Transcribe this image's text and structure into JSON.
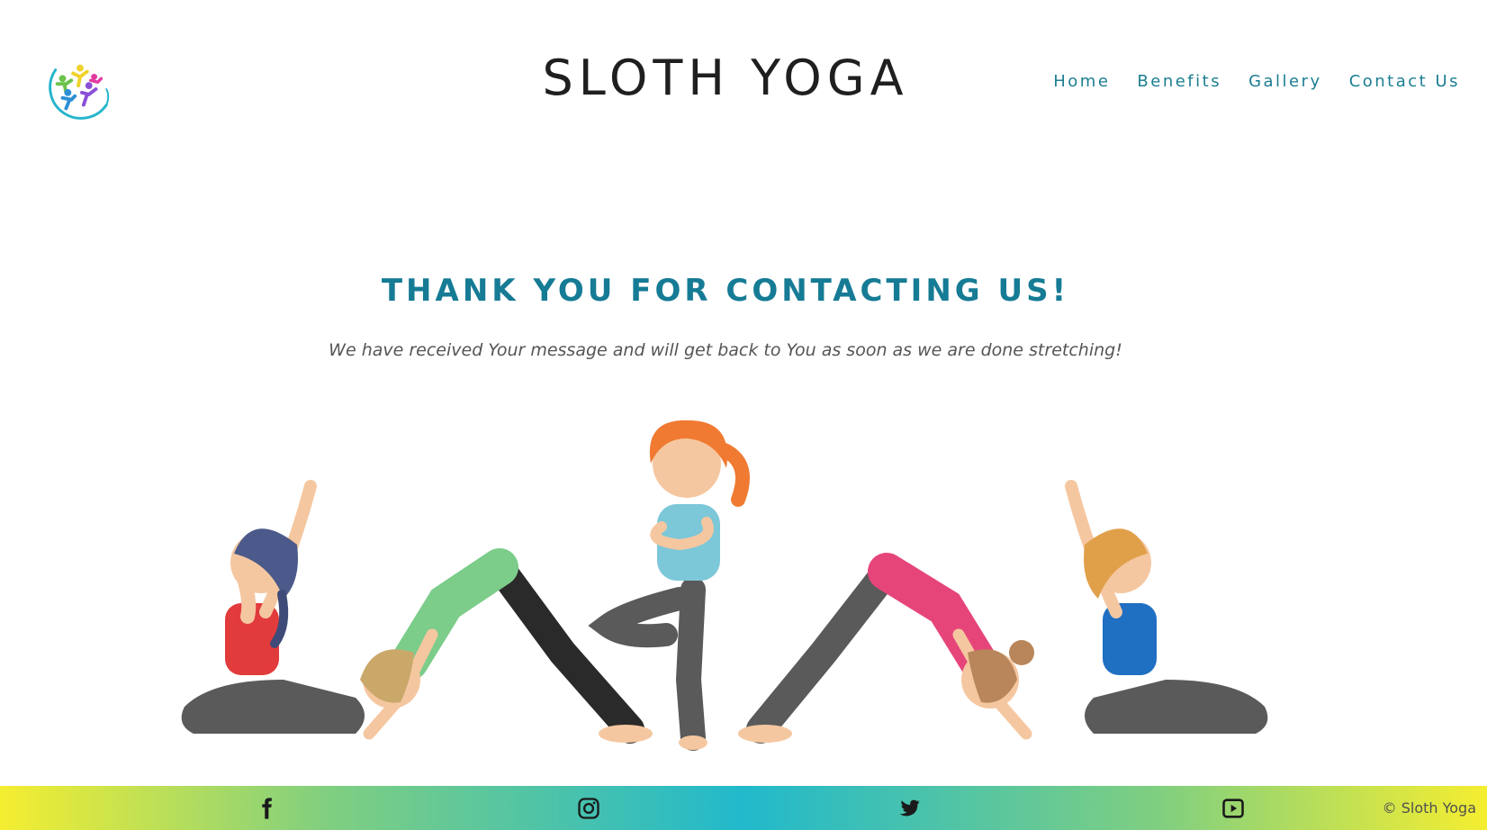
{
  "header": {
    "title": "SLOTH YOGA",
    "nav": [
      "Home",
      "Benefits",
      "Gallery",
      "Contact Us"
    ]
  },
  "main": {
    "heading": "THANK YOU FOR CONTACTING US!",
    "message": "We have received Your message and will get back to You as soon as we are done stretching!"
  },
  "footer": {
    "social": [
      "facebook-icon",
      "instagram-icon",
      "twitter-icon",
      "youtube-icon"
    ],
    "copyright": "© Sloth Yoga"
  },
  "colors": {
    "accent": "#1c7e92",
    "footer_gradient": [
      "#f5ee30",
      "#21b9cc"
    ]
  }
}
